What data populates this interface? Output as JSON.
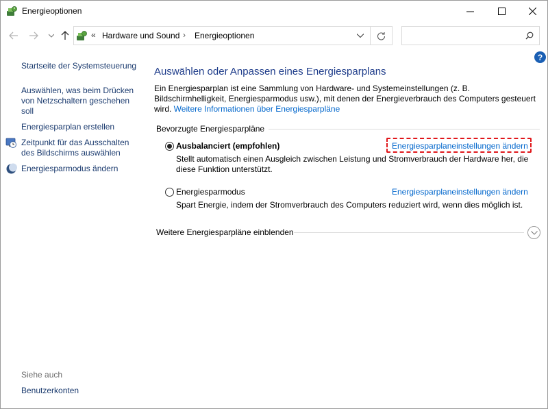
{
  "window": {
    "title": "Energieoptionen",
    "icon": "power-options-icon"
  },
  "addressbar": {
    "overflow": "«",
    "crumbs": [
      "Hardware und Sound",
      "Energieoptionen"
    ],
    "separator": "›",
    "search_placeholder": ""
  },
  "sidebar": {
    "items": [
      {
        "label": "Startseite der Systemsteuerung"
      },
      {
        "label": "Auswählen, was beim Drücken von Netzschaltern geschehen soll"
      },
      {
        "label": "Energiesparplan erstellen"
      },
      {
        "label": "Zeitpunkt für das Ausschalten des Bildschirms auswählen",
        "icon": "monitor-clock-icon"
      },
      {
        "label": "Energiesparmodus ändern",
        "icon": "moon-icon"
      }
    ],
    "see_also": "Siehe auch",
    "see_also_link": "Benutzerkonten"
  },
  "main": {
    "title": "Auswählen oder Anpassen eines Energiesparplans",
    "intro": "Ein Energiesparplan ist eine Sammlung von Hardware- und Systemeinstellungen (z. B. Bildschirmhelligkeit, Energiesparmodus usw.), mit denen der Energieverbrauch des Computers gesteuert wird. ",
    "intro_link": "Weitere Informationen über Energiesparpläne",
    "group_label": "Bevorzugte Energiesparpläne",
    "plans": [
      {
        "name": "Ausbalanciert (empfohlen)",
        "selected": true,
        "description": "Stellt automatisch einen Ausgleich zwischen Leistung und Stromverbrauch der Hardware her, die diese Funktion unterstützt.",
        "link": "Energiesparplaneinstellungen ändern"
      },
      {
        "name": "Energiesparmodus",
        "selected": false,
        "description": "Spart Energie, indem der Stromverbrauch des Computers reduziert wird, wenn dies möglich ist.",
        "link": "Energiesparplaneinstellungen ändern"
      }
    ],
    "more_plans": "Weitere Energiesparpläne einblenden"
  },
  "colors": {
    "link": "#0066cc",
    "title": "#1e3c8a",
    "highlight": "#e0161a"
  }
}
